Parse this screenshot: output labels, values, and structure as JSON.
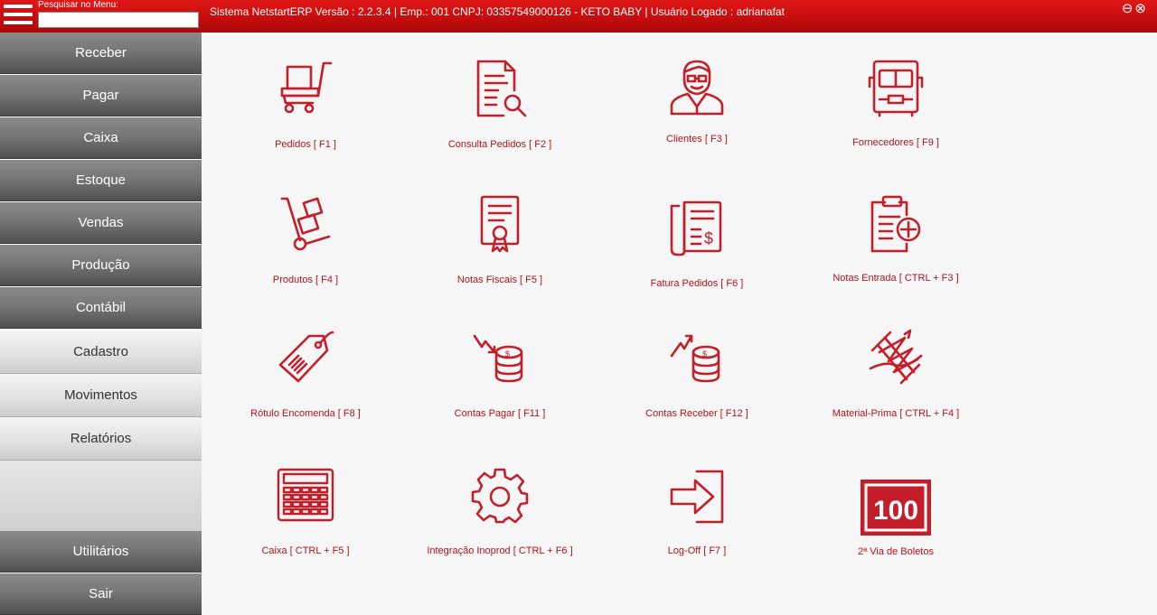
{
  "topbar": {
    "search_label": "Pesquisar no Menu:",
    "search_value": "",
    "system_info": "Sistema  NetstartERP Versão : 2.2.3.4  |  Emp.: 001 CNPJ: 03357549000126 - KETO BABY  |  Usuário Logado : adrianafat",
    "window_controls": "⊖⊗"
  },
  "sidebar": {
    "receber": "Receber",
    "pagar": "Pagar",
    "caixa": "Caixa",
    "estoque": "Estoque",
    "vendas": "Vendas",
    "producao": "Produção",
    "contabil": "Contábil",
    "cadastro": "Cadastro",
    "movimentos": "Movimentos",
    "relatorios": "Relatórios",
    "utilitarios": "Utilitários",
    "sair": "Sair"
  },
  "tiles": {
    "pedidos": "Pedidos  [ F1 ]",
    "consulta_pedidos": "Consulta Pedidos  [ F2 ]",
    "clientes": "Clientes  [ F3 ]",
    "fornecedores": "Fornecedores [ F9 ]",
    "produtos": "Produtos  [ F4 ]",
    "notas_fiscais": "Notas Fiscais  [ F5 ]",
    "fatura_pedidos": "Fatura Pedidos  [ F6 ]",
    "notas_entrada": "Notas Entrada [ CTRL + F3 ]",
    "rotulo_encomenda": "Rótulo Encomenda  [ F8 ]",
    "contas_pagar": "Contas Pagar [ F11 ]",
    "contas_receber": "Contas Receber [ F12 ]",
    "material_prima": "Material-Prima [ CTRL + F4 ]",
    "caixa": "Caixa [ CTRL + F5 ]",
    "integracao": "Integração Inoprod [ CTRL + F6 ]",
    "logoff": "Log-Off  [ F7 ]",
    "segunda_via": "2ª Via de Boletos",
    "boleto_icon_text": "100"
  },
  "colors": {
    "accent": "#c8102e",
    "icon": "#c41e2a",
    "topbar": "#cc1111"
  }
}
